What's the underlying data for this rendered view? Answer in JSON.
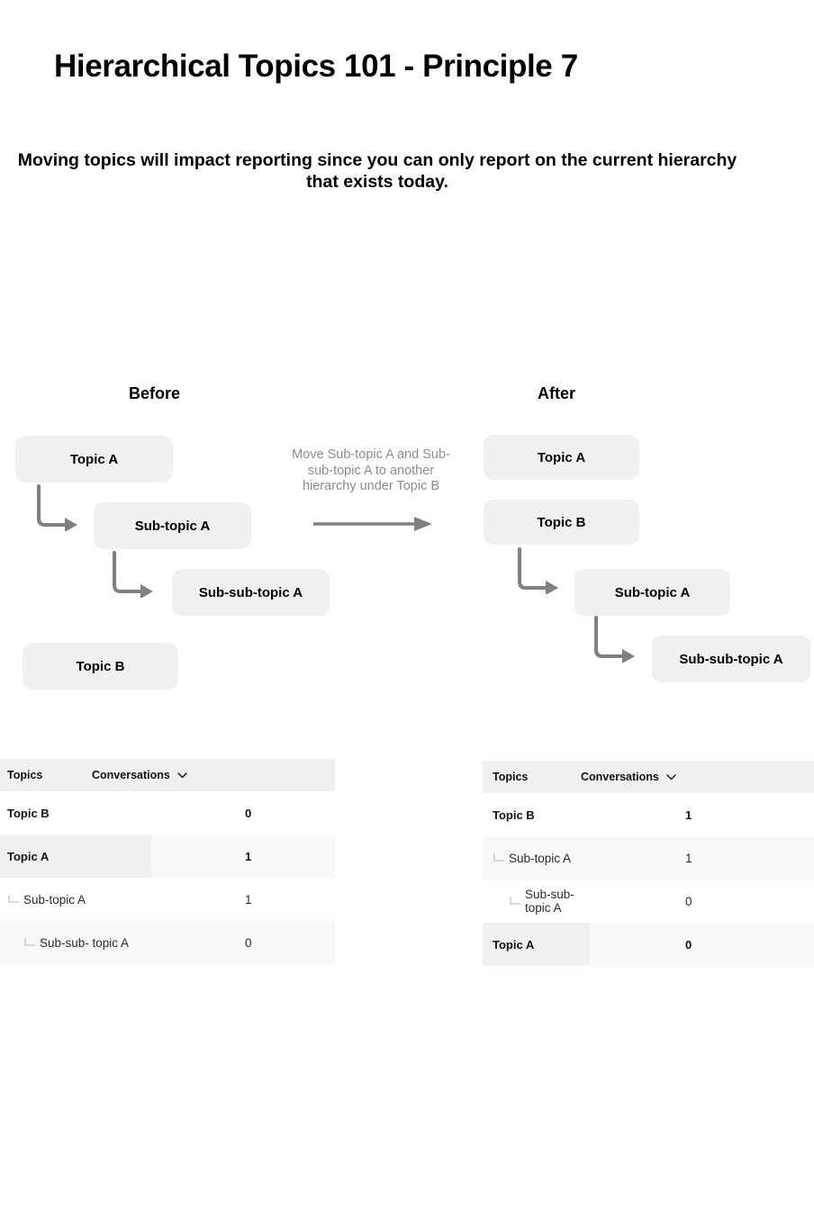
{
  "page": {
    "title": "Hierarchical Topics 101 - Principle 7",
    "subtitle": "Moving topics will impact reporting since you can only report on the current hierarchy that exists today."
  },
  "diagram": {
    "before": {
      "heading": "Before",
      "nodes": [
        {
          "label": "Topic A",
          "level": 0
        },
        {
          "label": "Sub-topic A",
          "level": 1
        },
        {
          "label": "Sub-sub-topic A",
          "level": 2
        },
        {
          "label": "Topic B",
          "level": 0
        }
      ]
    },
    "after": {
      "heading": "After",
      "nodes": [
        {
          "label": "Topic A",
          "level": 0
        },
        {
          "label": "Topic B",
          "level": 0
        },
        {
          "label": "Sub-topic A",
          "level": 1
        },
        {
          "label": "Sub-sub-topic A",
          "level": 2
        }
      ]
    },
    "move_note": "Move Sub-topic A and Sub-sub-topic A to another hierarchy under Topic B"
  },
  "tables": {
    "before": {
      "columns": [
        "Topics",
        "Conversations"
      ],
      "sort_icon": "chevron-down-icon",
      "rows": [
        {
          "topic": "Topic B",
          "conversations": "0",
          "level": 0,
          "shade": "white"
        },
        {
          "topic": "Topic A",
          "conversations": "1",
          "level": 0,
          "shade": "alt"
        },
        {
          "topic": "Sub-topic A",
          "conversations": "1",
          "level": 1,
          "shade": "white"
        },
        {
          "topic": "Sub-sub- topic A",
          "conversations": "0",
          "level": 2,
          "shade": "light"
        }
      ]
    },
    "after": {
      "columns": [
        "Topics",
        "Conversations"
      ],
      "sort_icon": "chevron-down-icon",
      "rows": [
        {
          "topic": "Topic B",
          "conversations": "1",
          "level": 0,
          "shade": "white"
        },
        {
          "topic": "Sub-topic A",
          "conversations": "1",
          "level": 1,
          "shade": "light"
        },
        {
          "topic": "Sub-sub-topic A",
          "conversations": "0",
          "level": 2,
          "shade": "white"
        },
        {
          "topic": "Topic A",
          "conversations": "0",
          "level": 0,
          "shade": "alt"
        }
      ]
    }
  },
  "colors": {
    "node_fill": "#f0f0f0",
    "arrow": "#808080",
    "note_text": "#8c8c8c",
    "header_fill": "#f0f0f0",
    "row_alt_fill": "#f8f8f8",
    "text": "#000000"
  }
}
